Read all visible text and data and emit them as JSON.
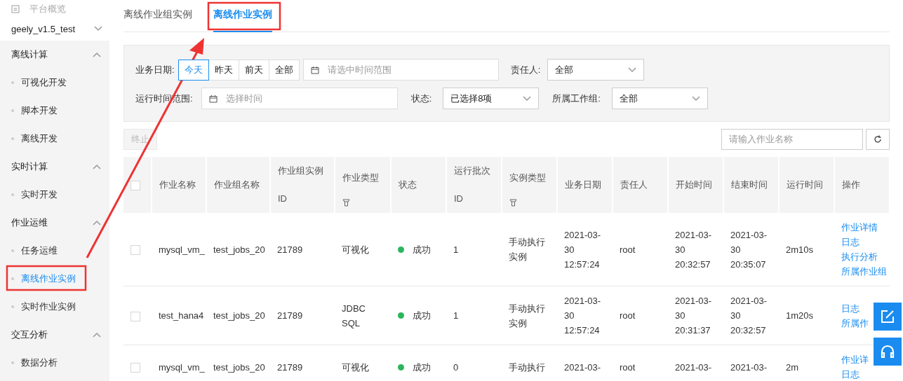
{
  "sidebar": {
    "overview": {
      "label": "平台概览",
      "disabled": true
    },
    "project": "geely_v1.5_test",
    "groups": [
      {
        "label": "离线计算",
        "expanded": true,
        "items": [
          {
            "label": "可视化开发",
            "selected": false
          },
          {
            "label": "脚本开发",
            "selected": false
          },
          {
            "label": "离线开发",
            "selected": false
          }
        ]
      },
      {
        "label": "实时计算",
        "expanded": true,
        "items": [
          {
            "label": "实时开发",
            "selected": false
          }
        ]
      },
      {
        "label": "作业运维",
        "expanded": true,
        "items": [
          {
            "label": "任务运维",
            "selected": false
          },
          {
            "label": "离线作业实例",
            "selected": true
          },
          {
            "label": "实时作业实例",
            "selected": false
          }
        ]
      },
      {
        "label": "交互分析",
        "expanded": true,
        "items": [
          {
            "label": "数据分析",
            "selected": false
          }
        ]
      }
    ]
  },
  "tabs": [
    {
      "label": "离线作业组实例",
      "selected": false
    },
    {
      "label": "离线作业实例",
      "selected": true
    }
  ],
  "filters": {
    "date_label": "业务日期:",
    "date_options": [
      {
        "label": "今天",
        "selected": true
      },
      {
        "label": "昨天",
        "selected": false
      },
      {
        "label": "前天",
        "selected": false
      },
      {
        "label": "全部",
        "selected": false
      }
    ],
    "date_range": {
      "placeholder": "请选中时间范围"
    },
    "owner": {
      "label": "责任人:",
      "value": "全部"
    },
    "run_time": {
      "label": "运行时间范围:",
      "placeholder": "选择时间"
    },
    "status": {
      "label": "状态:",
      "value": "已选择8项"
    },
    "workgroup": {
      "label": "所属工作组:",
      "value": "全部"
    }
  },
  "toolbar": {
    "stop_button": {
      "label": "终止",
      "disabled": true
    },
    "search": {
      "placeholder": "请输入作业名称"
    }
  },
  "table": {
    "header_checked": false,
    "columns": [
      {
        "label": "作业名称",
        "filter": false
      },
      {
        "label": "作业组名称",
        "filter": false
      },
      {
        "label": "作业组实例ID",
        "filter": false
      },
      {
        "label": "作业类型",
        "filter": true
      },
      {
        "label": "状态",
        "filter": false
      },
      {
        "label": "运行批次ID",
        "filter": false
      },
      {
        "label": "实例类型",
        "filter": true
      },
      {
        "label": "业务日期",
        "filter": false
      },
      {
        "label": "责任人",
        "filter": false
      },
      {
        "label": "开始时间",
        "filter": false
      },
      {
        "label": "结束时间",
        "filter": false
      },
      {
        "label": "运行时间",
        "filter": false
      },
      {
        "label": "操作",
        "filter": false
      }
    ],
    "rows": [
      {
        "checked": false,
        "cells": [
          "mysql_vm_",
          "test_jobs_20",
          "21789",
          "可视化"
        ],
        "status": {
          "label": "成功",
          "color": "#2db55d"
        },
        "rest": [
          "1",
          "手动执行实例",
          "2021-03-30 12:57:24",
          "root",
          "2021-03-30 20:32:57",
          "2021-03-30 20:35:07",
          "2m10s"
        ],
        "actions": [
          "作业详情",
          "日志",
          "执行分析",
          "所属作业组"
        ]
      },
      {
        "checked": false,
        "cells": [
          "test_hana4",
          "test_jobs_20",
          "21789",
          "JDBC SQL"
        ],
        "status": {
          "label": "成功",
          "color": "#2db55d"
        },
        "rest": [
          "1",
          "手动执行实例",
          "2021-03-30 12:57:24",
          "root",
          "2021-03-30 20:31:37",
          "2021-03-30 20:32:57",
          "1m20s"
        ],
        "actions": [
          "日志",
          "所属作"
        ]
      },
      {
        "checked": false,
        "cells": [
          "mysql_vm_",
          "test_jobs_20",
          "21789",
          "可视化"
        ],
        "status": {
          "label": "成功",
          "color": "#2db55d"
        },
        "rest": [
          "0",
          "手动执行",
          "2021-03-",
          "root",
          "2021-03-",
          "2021-03-",
          "2m"
        ],
        "actions": [
          "作业详",
          "日志"
        ]
      }
    ]
  }
}
